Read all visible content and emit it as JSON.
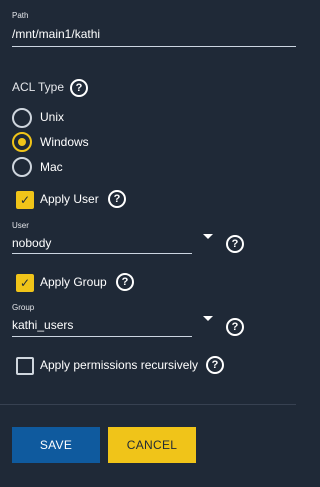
{
  "path": {
    "label": "Path",
    "value": "/mnt/main1/kathi"
  },
  "acl": {
    "title": "ACL Type",
    "options": [
      {
        "label": "Unix",
        "selected": false
      },
      {
        "label": "Windows",
        "selected": true
      },
      {
        "label": "Mac",
        "selected": false
      }
    ]
  },
  "apply_user": {
    "label": "Apply User",
    "checked": true
  },
  "user": {
    "label": "User",
    "value": "nobody"
  },
  "apply_group": {
    "label": "Apply Group",
    "checked": true
  },
  "group": {
    "label": "Group",
    "value": "kathi_users"
  },
  "recursive": {
    "label": "Apply permissions recursively",
    "checked": false
  },
  "buttons": {
    "save": "SAVE",
    "cancel": "CANCEL"
  },
  "colors": {
    "background": "#1f2937",
    "accent": "#f0c419",
    "primary": "#0f5a9e",
    "text": "#ffffff"
  },
  "icons": {
    "help": "help-circle-icon",
    "check": "checkmark-icon",
    "dropdown": "chevron-down-icon"
  }
}
